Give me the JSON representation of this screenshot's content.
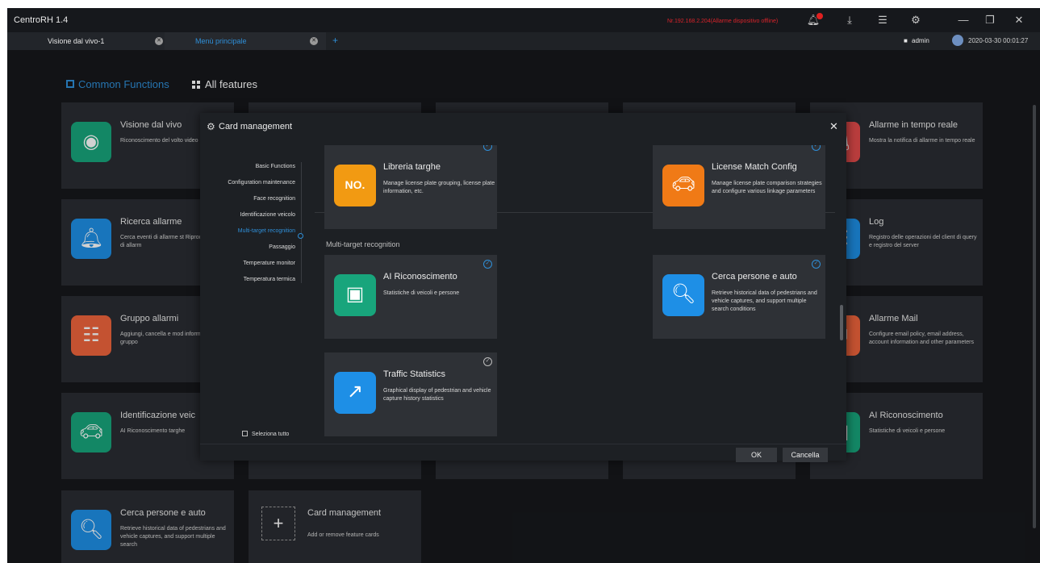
{
  "app": {
    "title": "CentroRH 1.4",
    "alarm_text": "Nr.192.168.2.204(Allarme dispositivo offline)"
  },
  "tabs": [
    {
      "label": "Visione dal vivo-1"
    },
    {
      "label": "Menù principale"
    }
  ],
  "user": {
    "name": "admin",
    "datetime": "2020-03-30 00:01:27"
  },
  "feature_tabs": {
    "common": "Common Functions",
    "all": "All features"
  },
  "background_cards": [
    {
      "title": "Visione dal vivo",
      "desc": "Riconoscimento del volto video",
      "icon": "eye-icon",
      "color": "#18a57c"
    },
    {
      "title": "Ricerca allarme",
      "desc": "Cerca eventi di allarme st Riproduci video di allarm",
      "icon": "bell-search-icon",
      "color": "#1e8fe6"
    },
    {
      "title": "Gruppo allarmi",
      "desc": "Aggiungi, cancella e mod informazioni del gruppo",
      "icon": "org-chart-icon",
      "color": "#f0643c"
    },
    {
      "title": "Identificazione veic",
      "desc": "AI Riconoscimento targhe",
      "icon": "car-icon",
      "color": "#18a57c"
    },
    {
      "title": "Cerca persone e auto",
      "desc": "Retrieve historical data of pedestrians and vehicle captures, and support multiple search",
      "icon": "person-car-search-icon",
      "color": "#1e8fe6"
    },
    {
      "title": "Allarme in tempo reale",
      "desc": "Mostra la notifica di allarme in tempo reale",
      "icon": "alarm-icon",
      "color": "#e34b4b"
    },
    {
      "title": "Log",
      "desc": "Registro delle operazioni del client di query e registro del server",
      "icon": "log-icon",
      "color": "#1e8fe6"
    },
    {
      "title": "Allarme Mail",
      "desc": "Configure email policy, email address, account information and other parameters",
      "icon": "mail-icon",
      "color": "#f0643c"
    },
    {
      "title": "AI Riconoscimento",
      "desc": "Statistiche di veicoli e persone",
      "icon": "ai-icon",
      "color": "#18a57c"
    }
  ],
  "add_card": {
    "title": "Card management",
    "desc": "Add or remove feature cards"
  },
  "modal": {
    "title": "Card management",
    "nav": [
      "Basic Functions",
      "Configuration maintenance",
      "Face recognition",
      "Identificazione veicolo",
      "Multi-target recognition",
      "Passaggio",
      "Temperature monitor",
      "Temperatura termica"
    ],
    "active_nav_index": 4,
    "section_label": "Multi-target recognition",
    "select_all": "Seleziona tutto",
    "ok": "OK",
    "cancel": "Cancella",
    "cards": [
      {
        "title": "Libreria targhe",
        "desc": "Manage license plate grouping, license plate information, etc.",
        "icon": "plate-icon",
        "color": "#f29a12",
        "checked": true
      },
      {
        "title": "License Match Config",
        "desc": "Manage license plate comparison strategies and configure various linkage parameters",
        "icon": "car-gear-icon",
        "color": "#f07a16",
        "checked": true
      },
      {
        "title": "AI Riconoscimento",
        "desc": "Statistiche di veicoli e persone",
        "icon": "ai-icon",
        "color": "#18a57c",
        "checked": true
      },
      {
        "title": "Cerca persone e auto",
        "desc": "Retrieve historical data of pedestrians and vehicle captures, and support multiple search conditions",
        "icon": "person-car-search-icon",
        "color": "#1e8fe6",
        "checked": true
      },
      {
        "title": "Traffic Statistics",
        "desc": "Graphical display of pedestrian and vehicle capture history statistics",
        "icon": "chart-icon",
        "color": "#1e8fe6",
        "checked": false
      }
    ]
  }
}
